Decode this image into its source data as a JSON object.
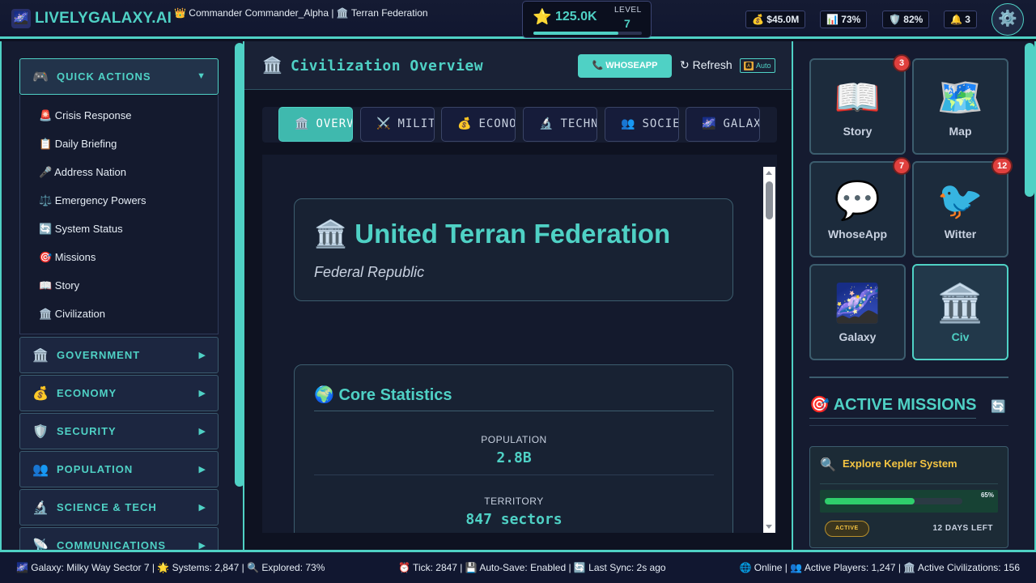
{
  "topbar": {
    "logo_icon": "🌌",
    "logo_text": "LIVELYGALAXY.AI",
    "commander_text": "👑 Commander Commander_Alpha | 🏛️ Terran Federation",
    "xp_icon": "⭐",
    "xp_value": "125.0K",
    "level_label": "LEVEL",
    "level_value": "7",
    "xp_progress_percent": 78,
    "stats": {
      "money": "💰 $45.0M",
      "approval": "📊 73%",
      "security": "🛡️ 82%",
      "notifications": "🔔 3"
    },
    "settings_icon": "⚙️"
  },
  "sidebar": {
    "quick_actions": {
      "icon": "🎮",
      "label": "QUICK ACTIONS",
      "arrow": "▼"
    },
    "quick_items": [
      "🚨 Crisis Response",
      "📋 Daily Briefing",
      "🎤 Address Nation",
      "⚖️ Emergency Powers",
      "🔄 System Status",
      "🎯 Missions",
      "📖 Story",
      "🏛️ Civilization"
    ],
    "sections": [
      {
        "icon": "🏛️",
        "label": "GOVERNMENT",
        "arrow": "▶"
      },
      {
        "icon": "💰",
        "label": "ECONOMY",
        "arrow": "▶"
      },
      {
        "icon": "🛡️",
        "label": "SECURITY",
        "arrow": "▶"
      },
      {
        "icon": "👥",
        "label": "POPULATION",
        "arrow": "▶"
      },
      {
        "icon": "🔬",
        "label": "SCIENCE & TECH",
        "arrow": "▶"
      },
      {
        "icon": "📡",
        "label": "COMMUNICATIONS",
        "arrow": "▶"
      }
    ]
  },
  "center": {
    "header_icon": "🏛️",
    "header_title": "Civilization Overview",
    "whoseapp_button": "📞 WHOSEAPP",
    "refresh_button": "↻ Refresh",
    "auto_badge_icon": "🅰",
    "auto_badge": "Auto",
    "tabs": [
      {
        "icon": "🏛️",
        "label": "OVERVIEW"
      },
      {
        "icon": "⚔️",
        "label": "MILITARY"
      },
      {
        "icon": "💰",
        "label": "ECONOMY"
      },
      {
        "icon": "🔬",
        "label": "TECHNOLOGY"
      },
      {
        "icon": "👥",
        "label": "SOCIETY"
      },
      {
        "icon": "🌌",
        "label": "GALAXY"
      }
    ],
    "civ_card": {
      "name": "🏛️ United Terran Federation",
      "government": "Federal Republic"
    },
    "core_stats": {
      "title": "🌍 Core Statistics",
      "items": [
        {
          "label": "POPULATION",
          "value": "2.8B"
        },
        {
          "label": "TERRITORY",
          "value": "847 sectors"
        }
      ]
    }
  },
  "right": {
    "apps": [
      {
        "icon": "📖",
        "label": "Story",
        "badge": "3"
      },
      {
        "icon": "🗺️",
        "label": "Map",
        "badge": ""
      },
      {
        "icon": "💬",
        "label": "WhoseApp",
        "badge": "7"
      },
      {
        "icon": "🐦",
        "label": "Witter",
        "badge": "12"
      },
      {
        "icon": "🌌",
        "label": "Galaxy",
        "badge": ""
      },
      {
        "icon": "🏛️",
        "label": "Civ",
        "badge": ""
      }
    ],
    "missions_title": "🎯 ACTIVE MISSIONS",
    "missions_refresh_icon": "🔄",
    "mission": {
      "icon": "🔍",
      "name": "Explore Kepler System",
      "progress_percent": 65,
      "progress_label": "65%",
      "status": "ACTIVE",
      "days_left": "12 DAYS LEFT"
    }
  },
  "footer": {
    "left": "🌌 Galaxy: Milky Way Sector 7 | 🌟 Systems: 2,847 | 🔍 Explored: 73%",
    "middle": "⏰ Tick: 2847 | 💾 Auto-Save: Enabled | 🔄 Last Sync: 2s ago",
    "right": "🌐 Online | 👥 Active Players: 1,247 | 🏛️ Active Civilizations: 156"
  },
  "colors": {
    "accent": "#4fd1c5",
    "background": "#0d1120",
    "panel": "#151b30",
    "badge": "#e0403e",
    "mission_title": "#f5c542",
    "progress": "#2fcf6b"
  }
}
